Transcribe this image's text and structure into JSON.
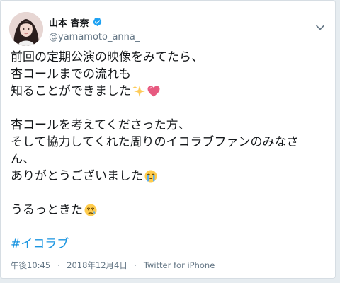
{
  "author": {
    "display_name": "山本 杏奈",
    "handle": "@yamamoto_anna_",
    "verified": true
  },
  "tweet": {
    "lines": [
      "前回の定期公演の映像をみてたら、",
      "杏コールまでの流れも",
      "知ることができました",
      "",
      "杏コールを考えてくださった方、",
      "そして協力してくれた周りのイコラブファンのみなさ",
      "ん、",
      "ありがとうございました",
      "",
      "うるっときた",
      "",
      "#イコラブ"
    ],
    "emojis": {
      "line3": [
        "sparkles-emoji",
        "heart-emoji"
      ],
      "line8": [
        "crying-emoji"
      ],
      "line10": [
        "tear-emoji"
      ]
    },
    "hashtag_color": "#1b95e0"
  },
  "meta": {
    "time": "午後10:45",
    "date": "2018年12月4日",
    "separator": "·",
    "source": "Twitter for iPhone"
  },
  "colors": {
    "text": "#14171a",
    "secondary": "#657786",
    "verified": "#1da1f2",
    "background": "#e6ecf0"
  }
}
